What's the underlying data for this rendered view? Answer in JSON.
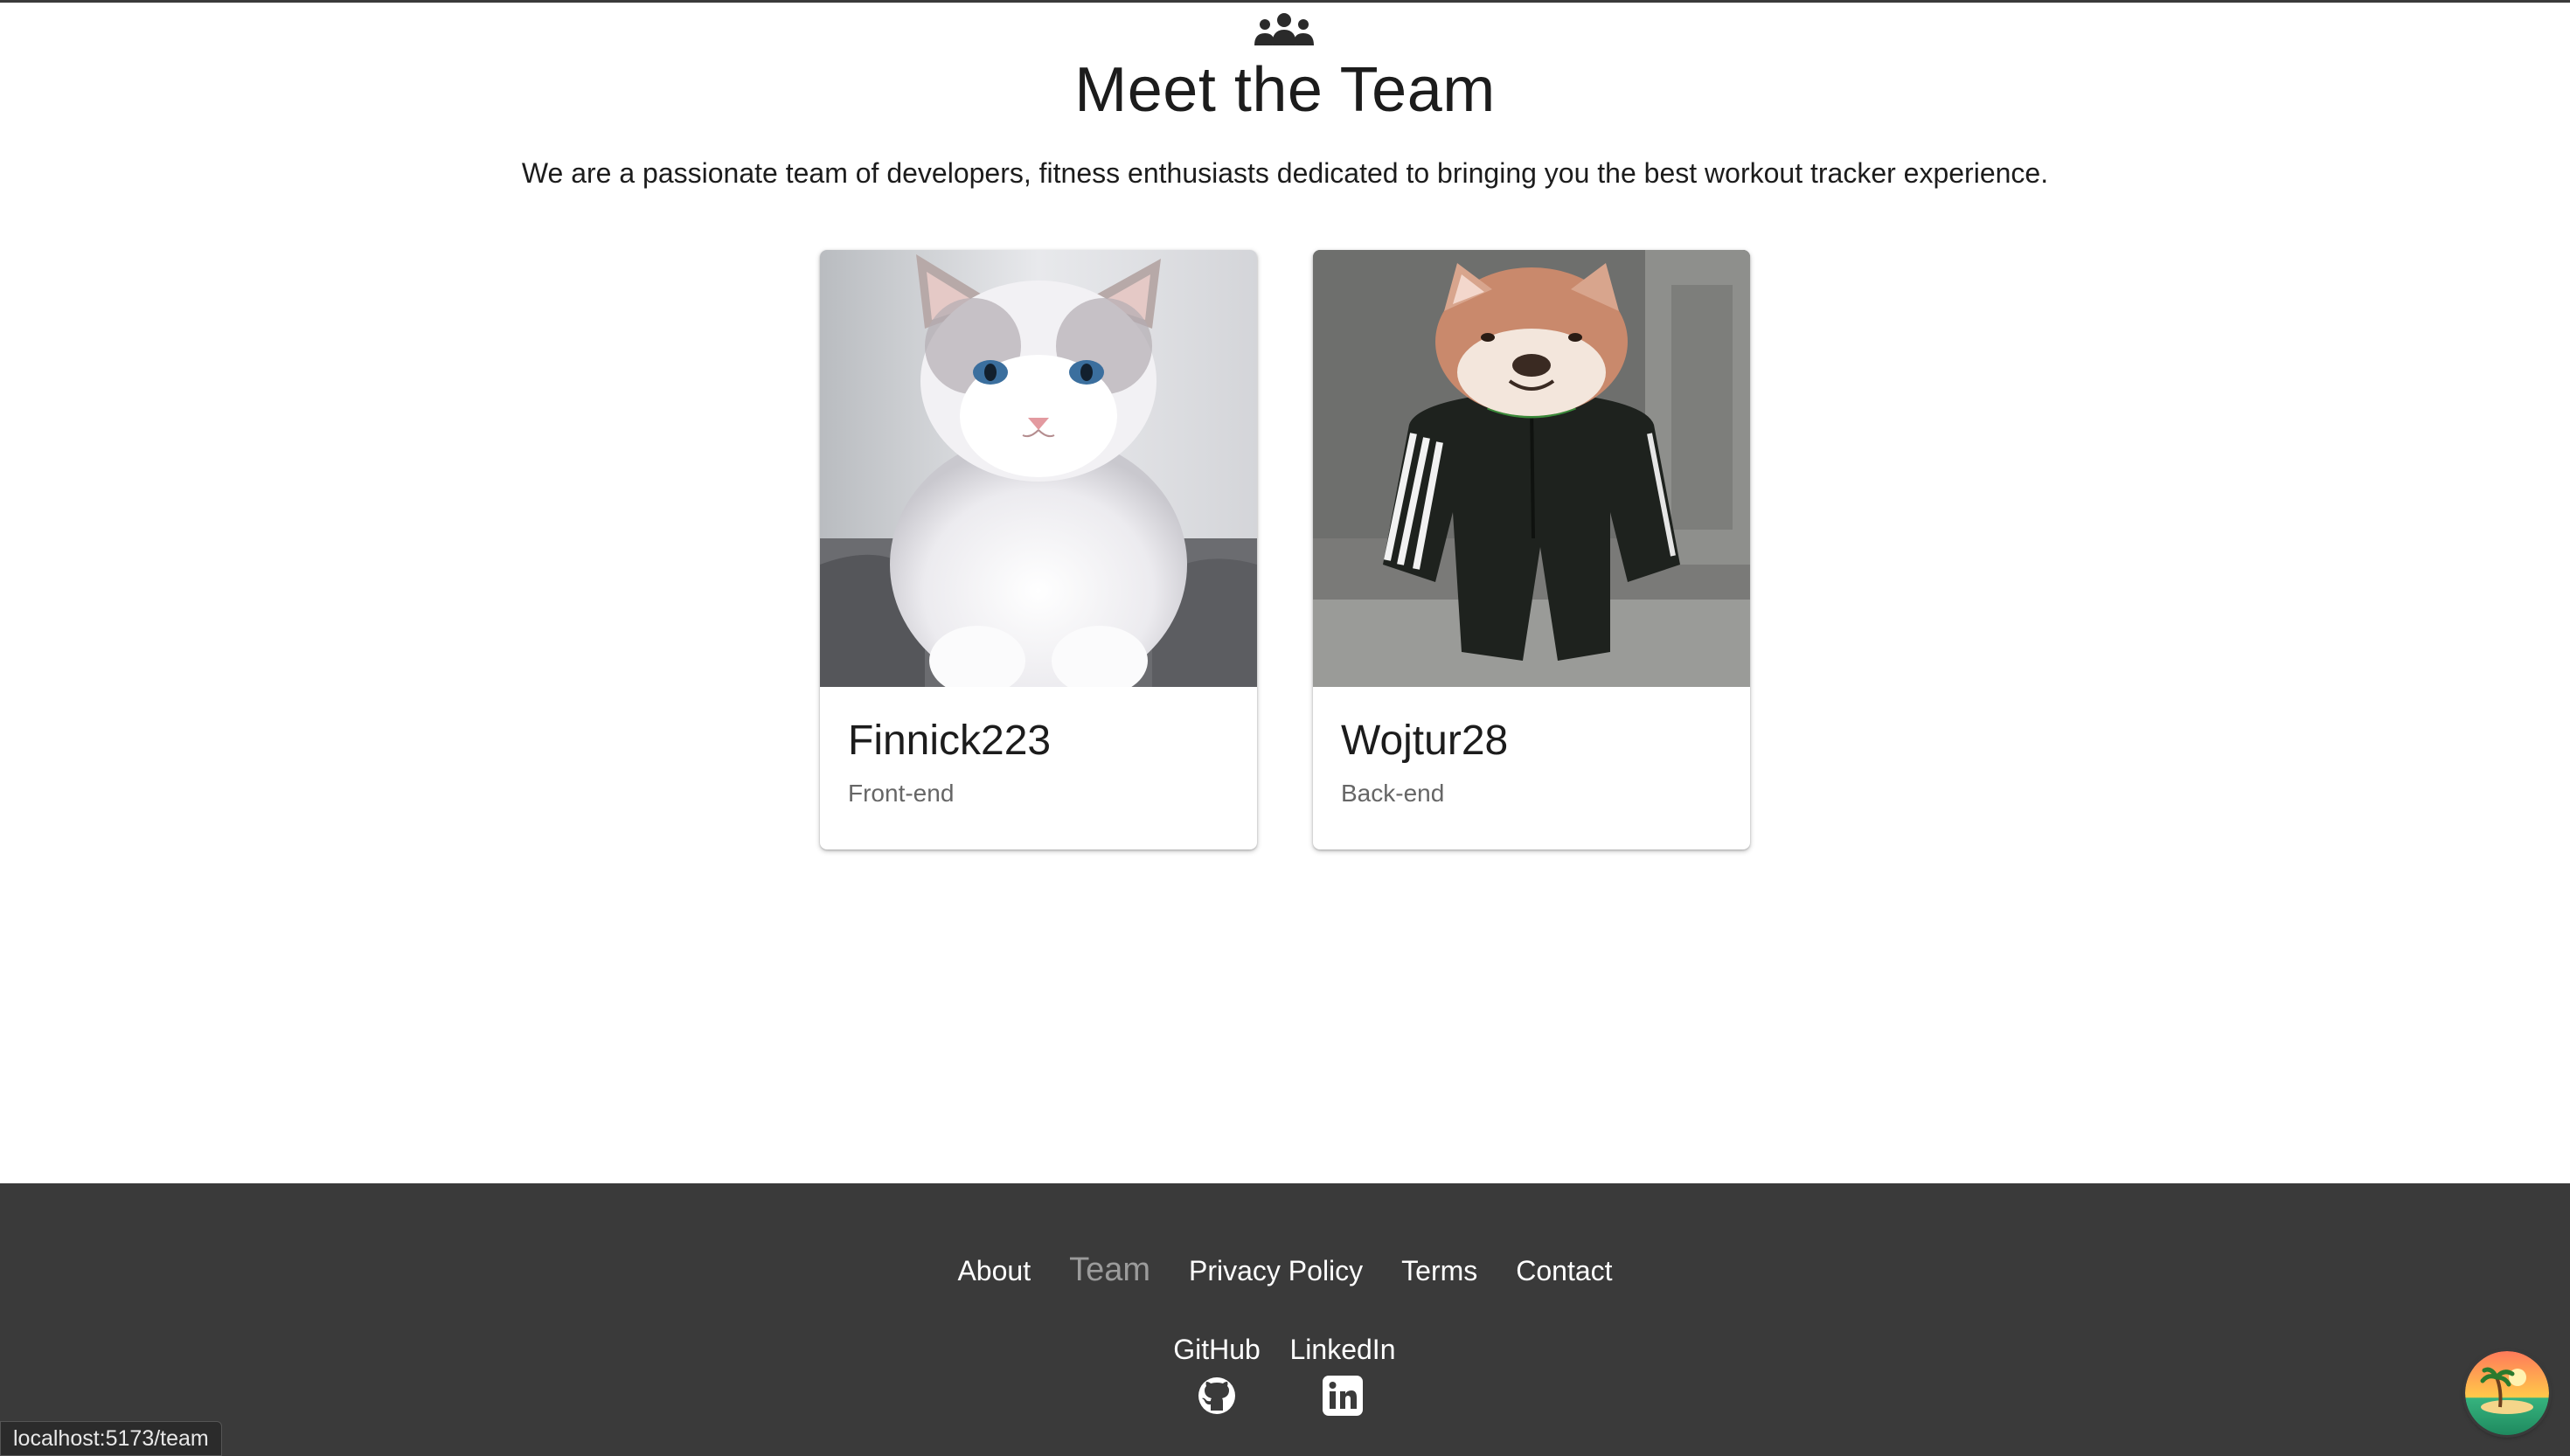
{
  "header": {
    "icon": "team-icon",
    "title": "Meet the Team",
    "subtitle": "We are a passionate team of developers, fitness enthusiasts dedicated to bringing you the best workout tracker experience."
  },
  "team": [
    {
      "name": "Finnick223",
      "role": "Front-end",
      "photo": "white-cat-photo"
    },
    {
      "name": "Wojtur28",
      "role": "Back-end",
      "photo": "dog-in-tracksuit-photo"
    }
  ],
  "footer": {
    "nav": [
      {
        "label": "About",
        "active": false
      },
      {
        "label": "Team",
        "active": true
      },
      {
        "label": "Privacy Policy",
        "active": false
      },
      {
        "label": "Terms",
        "active": false
      },
      {
        "label": "Contact",
        "active": false
      }
    ],
    "social": {
      "github": {
        "label": "GitHub",
        "icon": "github-icon"
      },
      "linkedin": {
        "label": "LinkedIn",
        "icon": "linkedin-icon"
      }
    }
  },
  "status_url": "localhost:5173/team",
  "colors": {
    "footer_bg": "#3a3a3a",
    "active_nav": "#9b9b9b",
    "text": "#1c1c1c",
    "muted": "#666666"
  }
}
